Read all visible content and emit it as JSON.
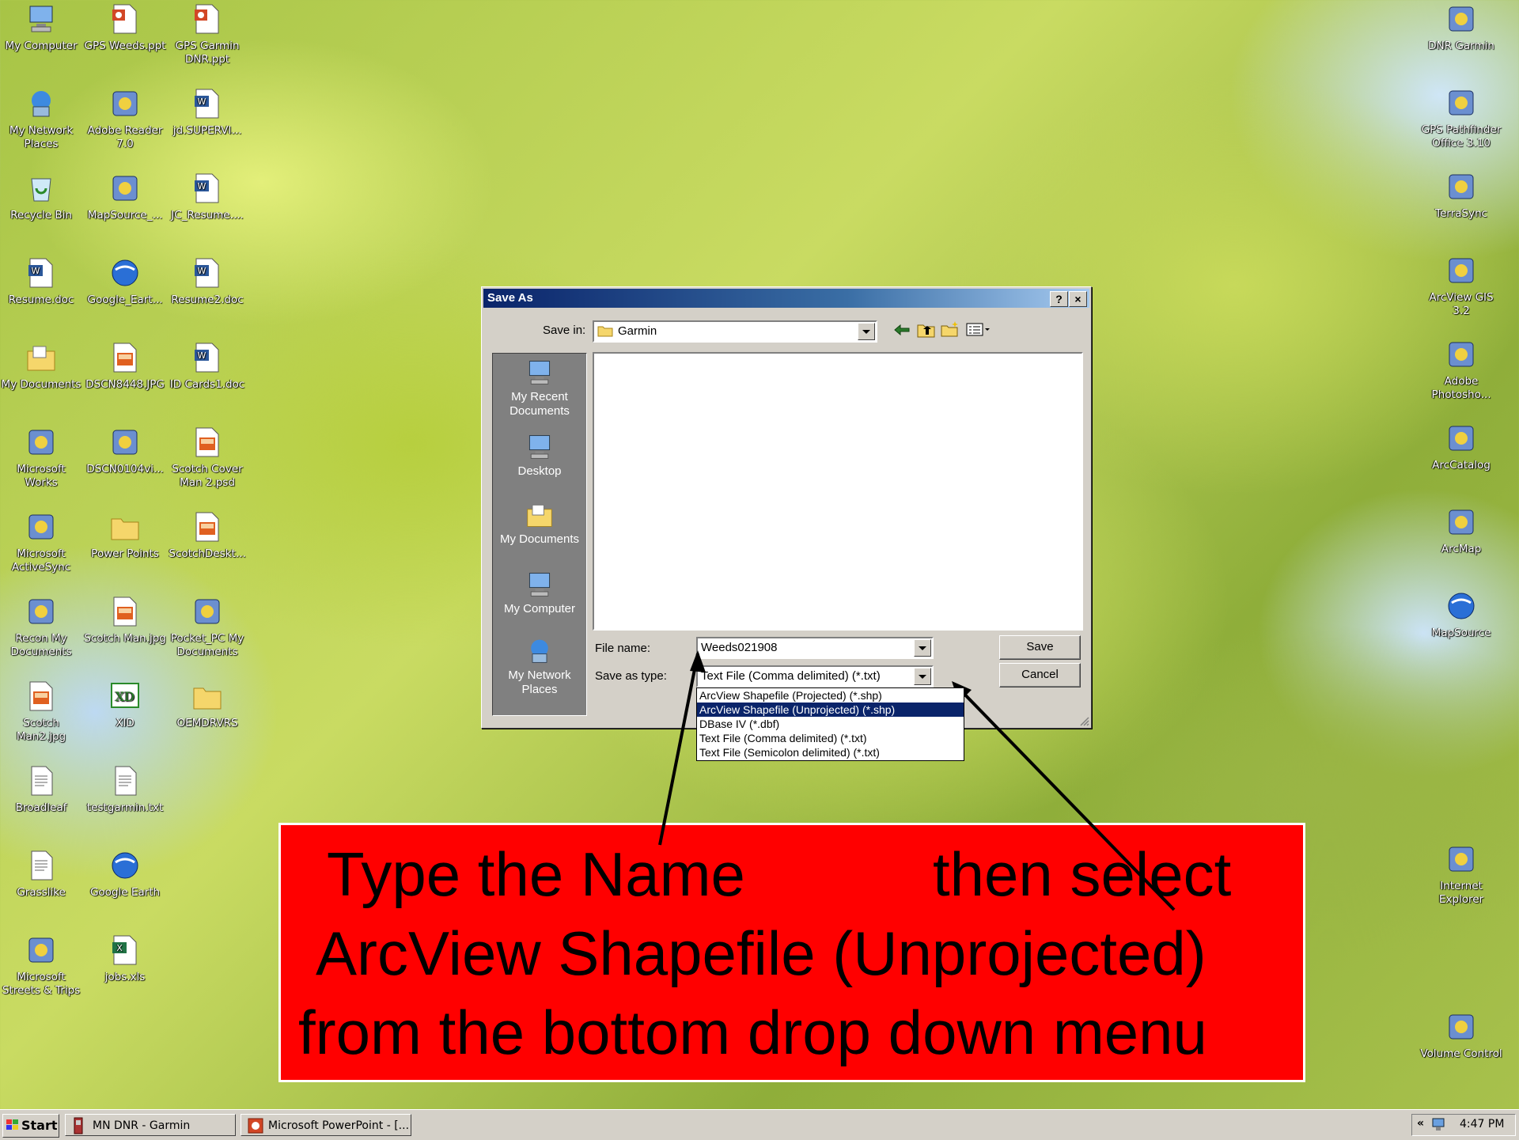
{
  "desktop": {
    "left_icons": [
      {
        "label": "My Computer",
        "icon": "computer-icon"
      },
      {
        "label": "GPS Weeds.ppt",
        "icon": "powerpoint-file-icon"
      },
      {
        "label": "GPS Garmin DNR.ppt",
        "icon": "powerpoint-file-icon"
      },
      {
        "label": "My Network Places",
        "icon": "network-icon"
      },
      {
        "label": "Adobe Reader 7.0",
        "icon": "adobe-reader-icon"
      },
      {
        "label": "jd.SUPERVI...",
        "icon": "word-document-icon"
      },
      {
        "label": "Recycle Bin",
        "icon": "recycle-bin-icon"
      },
      {
        "label": "MapSource_...",
        "icon": "mapsource-icon"
      },
      {
        "label": "JC_Resume....",
        "icon": "word-document-icon"
      },
      {
        "label": "Resume.doc",
        "icon": "word-document-icon"
      },
      {
        "label": "Google_Eart...",
        "icon": "google-earth-icon"
      },
      {
        "label": "Resume2.doc",
        "icon": "word-document-icon"
      },
      {
        "label": "My Documents",
        "icon": "my-documents-icon"
      },
      {
        "label": "DSCN8448.JPG",
        "icon": "image-file-icon"
      },
      {
        "label": "ID Cards1.doc",
        "icon": "word-document-icon"
      },
      {
        "label": "Microsoft Works",
        "icon": "works-icon"
      },
      {
        "label": "DSCN0104vi...",
        "icon": "media-file-icon"
      },
      {
        "label": "Scotch Cover Man 2.psd",
        "icon": "psd-file-icon"
      },
      {
        "label": "Microsoft ActiveSync",
        "icon": "activesync-icon"
      },
      {
        "label": "Power Points",
        "icon": "folder-icon"
      },
      {
        "label": "ScotchDeskt...",
        "icon": "image-file-icon"
      },
      {
        "label": "Recon My Documents",
        "icon": "sync-folder-icon"
      },
      {
        "label": "Scotch Man.jpg",
        "icon": "image-file-icon"
      },
      {
        "label": "Pocket_PC My Documents",
        "icon": "sync-folder-icon"
      },
      {
        "label": "Scotch Man2.jpg",
        "icon": "image-file-icon"
      },
      {
        "label": "XID",
        "icon": "xid-icon"
      },
      {
        "label": "OEMDRVRS",
        "icon": "folder-icon"
      },
      {
        "label": "Broadleaf",
        "icon": "data-file-icon"
      },
      {
        "label": "testgarmin.txt",
        "icon": "text-file-icon"
      },
      {
        "label": "Grasslike",
        "icon": "data-file-icon"
      },
      {
        "label": "Google Earth",
        "icon": "google-earth-icon"
      },
      {
        "label": "Microsoft Streets & Trips",
        "icon": "streets-trips-icon"
      },
      {
        "label": "jobs.xls",
        "icon": "excel-file-icon"
      }
    ],
    "right_icons": [
      {
        "label": "DNR Garmin",
        "icon": "garmin-icon"
      },
      {
        "label": "GPS Pathfinder Office 3.10",
        "icon": "pathfinder-icon"
      },
      {
        "label": "TerraSync",
        "icon": "terrasync-icon"
      },
      {
        "label": "ArcView GIS 3.2",
        "icon": "arcview-icon"
      },
      {
        "label": "Adobe Photosho...",
        "icon": "photoshop-icon"
      },
      {
        "label": "ArcCatalog",
        "icon": "arccatalog-icon"
      },
      {
        "label": "ArcMap",
        "icon": "arcmap-icon"
      },
      {
        "label": "MapSource",
        "icon": "globe-icon"
      },
      {
        "label": "Internet Explorer",
        "icon": "internet-explorer-icon"
      },
      {
        "label": "Volume Control",
        "icon": "volume-icon"
      }
    ]
  },
  "dialog": {
    "title": "Save As",
    "help_button": "?",
    "close_button": "×",
    "save_in_label": "Save in:",
    "save_in_value": "Garmin",
    "places": [
      {
        "label": "My Recent Documents",
        "icon": "recent-documents-icon"
      },
      {
        "label": "Desktop",
        "icon": "desktop-icon"
      },
      {
        "label": "My Documents",
        "icon": "my-documents-icon"
      },
      {
        "label": "My Computer",
        "icon": "computer-icon"
      },
      {
        "label": "My Network Places",
        "icon": "network-icon"
      }
    ],
    "file_name_label": "File name:",
    "file_name_value": "Weeds021908",
    "save_as_type_label": "Save as type:",
    "save_as_type_value": "Text File (Comma delimited) (*.txt)",
    "save_button": "Save",
    "cancel_button": "Cancel",
    "type_options": [
      "ArcView Shapefile (Projected) (*.shp)",
      "ArcView Shapefile (Unprojected) (*.shp)",
      "DBase IV (*.dbf)",
      "Text File (Comma delimited) (*.txt)",
      "Text File (Semicolon delimited) (*.txt)"
    ],
    "selected_option_index": 1
  },
  "annotation": {
    "line1a": "Type the Name",
    "line1b": "then select",
    "line2": "ArcView Shapefile (Unprojected)",
    "line3": "from the bottom drop down menu",
    "background_color": "#ff0000"
  },
  "taskbar": {
    "start_label": "Start",
    "tasks": [
      {
        "label": "MN DNR - Garmin",
        "icon": "garmin-icon"
      },
      {
        "label": "Microsoft PowerPoint - [...",
        "icon": "powerpoint-icon"
      }
    ],
    "tray_expand": "«",
    "clock": "4:47 PM"
  }
}
